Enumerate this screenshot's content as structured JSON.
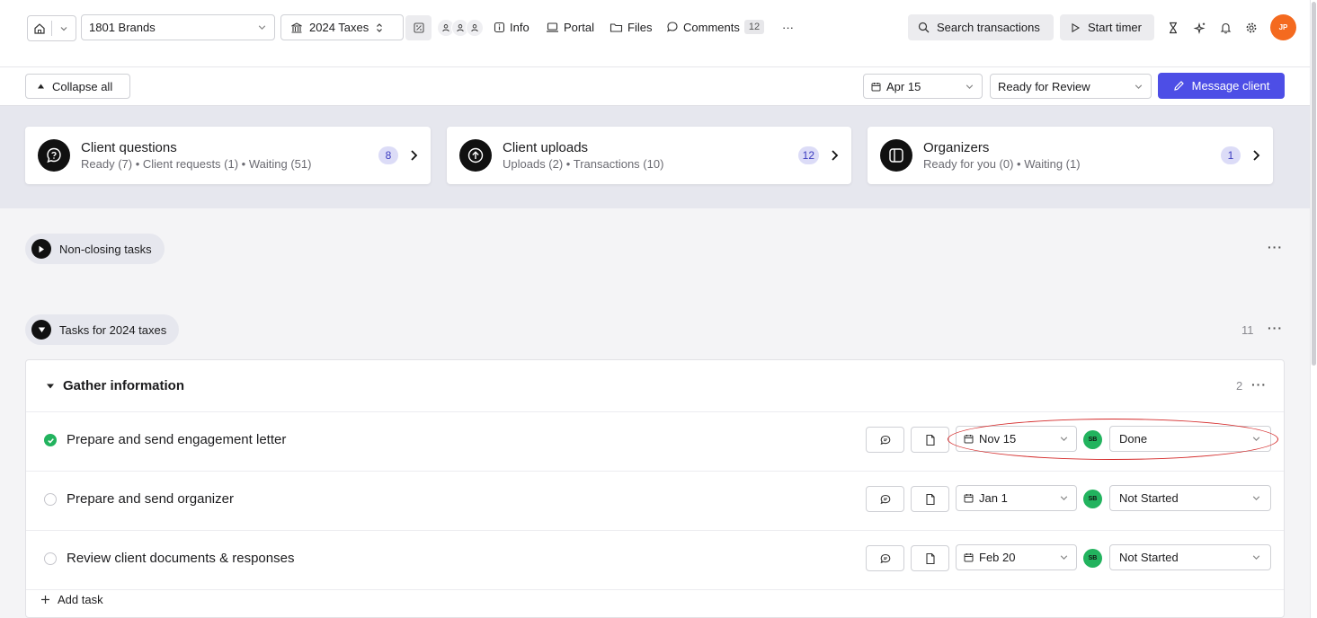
{
  "header": {
    "client": "1801 Brands",
    "project": "2024 Taxes",
    "nav": {
      "info": "Info",
      "portal": "Portal",
      "files": "Files",
      "comments": "Comments",
      "comments_count": "12",
      "more": "···"
    },
    "search_label": "Search transactions",
    "timer_label": "Start timer",
    "user_initials": "JP"
  },
  "subbar": {
    "collapse_label": "Collapse all",
    "due_date": "Apr 15",
    "status": "Ready for Review",
    "message_label": "Message client"
  },
  "summary": [
    {
      "title": "Client questions",
      "subtitle": "Ready (7) • Client requests (1) • Waiting (51)",
      "count": "8"
    },
    {
      "title": "Client uploads",
      "subtitle": "Uploads (2) • Transactions (10)",
      "count": "12"
    },
    {
      "title": "Organizers",
      "subtitle": "Ready for you (0) • Waiting (1)",
      "count": "1"
    }
  ],
  "sections": {
    "non_closing": "Non-closing tasks",
    "tasks_for": "Tasks for 2024 taxes",
    "tasks_count": "11"
  },
  "group": {
    "title": "Gather information",
    "count": "2"
  },
  "tasks": [
    {
      "name": "Prepare and send engagement letter",
      "date": "Nov 15",
      "assignee": "SB",
      "status": "Done",
      "done": true
    },
    {
      "name": "Prepare and send organizer",
      "date": "Jan 1",
      "assignee": "SB",
      "status": "Not Started",
      "done": false
    },
    {
      "name": "Review client documents & responses",
      "date": "Feb 20",
      "assignee": "SB",
      "status": "Not Started",
      "done": false
    }
  ],
  "add_task_label": "Add task",
  "colors": {
    "accent": "#4d4ee6",
    "done_green": "#22b35e",
    "avatar_orange": "#f46a1f",
    "annotation_red": "#d42a2a"
  }
}
